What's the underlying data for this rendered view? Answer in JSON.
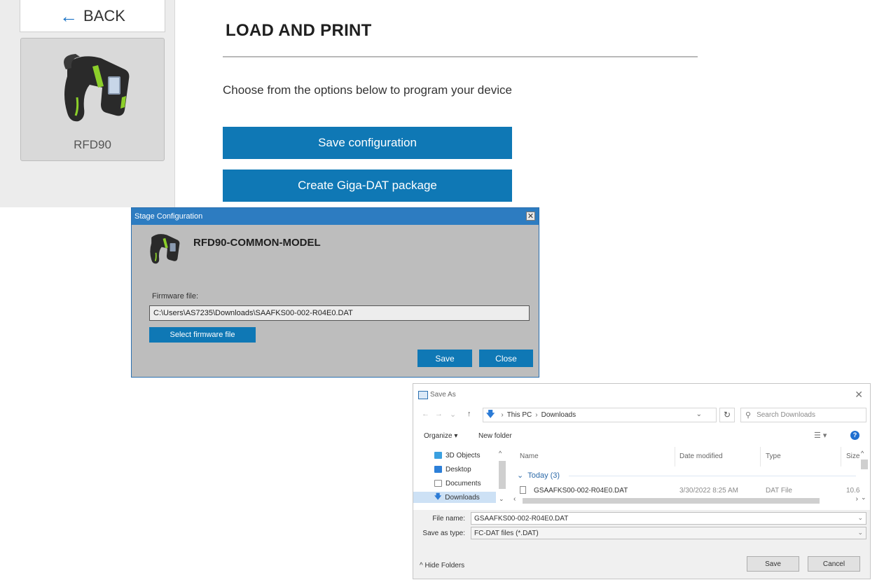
{
  "sidebar": {
    "back_label": "BACK",
    "device_name": "RFD90"
  },
  "main": {
    "title": "LOAD AND PRINT",
    "instructions": "Choose from the options below to program your device",
    "buttons": [
      "Save configuration",
      "Create Giga-DAT package"
    ]
  },
  "stage_dialog": {
    "title": "Stage Configuration",
    "model": "RFD90-COMMON-MODEL",
    "firmware_label": "Firmware file:",
    "firmware_path": "C:\\Users\\AS7235\\Downloads\\SAAFKS00-002-R04E0.DAT",
    "select_button": "Select firmware file",
    "save_button": "Save",
    "close_button": "Close"
  },
  "save_as": {
    "title": "Save As",
    "breadcrumb": [
      "This PC",
      "Downloads"
    ],
    "search_placeholder": "Search Downloads",
    "organize": "Organize ▾",
    "new_folder": "New folder",
    "tree": [
      "3D Objects",
      "Desktop",
      "Documents",
      "Downloads"
    ],
    "columns": [
      "Name",
      "Date modified",
      "Type",
      "Size"
    ],
    "group": "Today (3)",
    "file": {
      "name": "GSAAFKS00-002-R04E0.DAT",
      "date": "3/30/2022 8:25 AM",
      "type": "DAT File",
      "size": "10.6"
    },
    "file_name_label": "File name:",
    "file_name_value": "GSAAFKS00-002-R04E0.DAT",
    "save_type_label": "Save as type:",
    "save_type_value": "FC-DAT files (*.DAT)",
    "hide_folders": "Hide Folders",
    "save_button": "Save",
    "cancel_button": "Cancel"
  },
  "colors": {
    "accent_blue": "#0f78b5",
    "titlebar_blue": "#2d7cc1",
    "device_green": "#8ccf2a"
  }
}
